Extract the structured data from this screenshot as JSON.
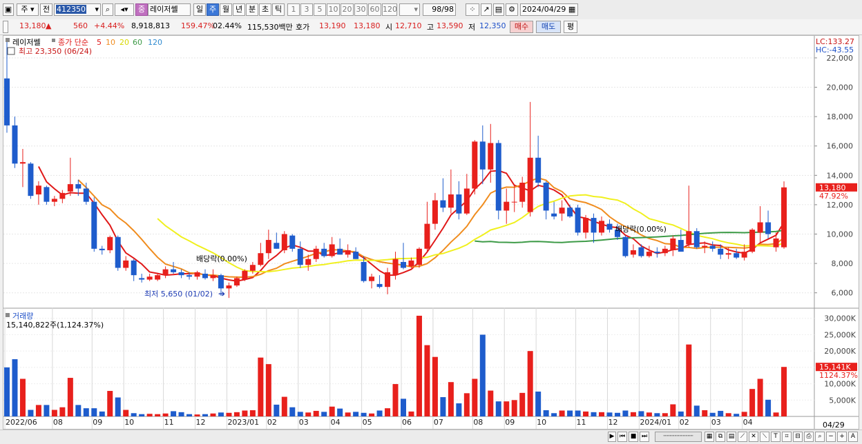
{
  "toolbar": {
    "market": "주",
    "scope": "전",
    "code": "412350",
    "name": "레이저쎌",
    "badge": "중",
    "periods": [
      "일",
      "주",
      "월",
      "년",
      "분",
      "초",
      "틱"
    ],
    "selected_period": "주",
    "minutes": [
      "1",
      "3",
      "5",
      "10",
      "20",
      "30",
      "60",
      "120"
    ],
    "count": "98/98",
    "date": "2024/04/29"
  },
  "quote": {
    "price": "13,180",
    "change": "560",
    "change_pct": "+4.44%",
    "volume": "8,918,813",
    "volume_ratio": "159.47%",
    "turnover": "02.44%",
    "amount": "115,530백만",
    "ask_label": "호가",
    "ask": "13,190",
    "bid": "13,180",
    "open_label": "시",
    "open": "12,710",
    "high_label": "고",
    "high": "13,590",
    "low_label": "저",
    "low": "12,350",
    "buy": "매수",
    "sell": "매도",
    "eval": "평"
  },
  "colors": {
    "up": "#e8201c",
    "down": "#1e5ccc",
    "ma5": "#e01818",
    "ma10": "#f08c1e",
    "ma20": "#f0f01e",
    "ma60": "#3c9a46",
    "ma120": "#2f8ad0"
  },
  "chart_data": {
    "type": "candlestick",
    "title": "레이저쎌",
    "legend": {
      "label": "종가 단순",
      "periods": [
        "5",
        "10",
        "20",
        "60",
        "120"
      ]
    },
    "lc_label": "LC:133.27",
    "hc_label": "HC:-43.55",
    "high_note": "최고 23,350 (06/24)",
    "low_note": "최저 5,650 (01/02)",
    "dividend_notes": [
      "배당락(0.00%)",
      "배당락(0.00%)"
    ],
    "price_axis": {
      "min": 5000,
      "max": 23500,
      "ticks": [
        6000,
        8000,
        10000,
        12000,
        14000,
        16000,
        18000,
        20000,
        22000
      ],
      "tick_labels": [
        "6,000",
        "8,000",
        "10,000",
        "12,000",
        "14,000",
        "16,000",
        "18,000",
        "20,000",
        "22,000"
      ]
    },
    "current_price_label": "13,180",
    "current_pct_label": "47.92%",
    "volume_title": "거래량",
    "volume_info": "15,140,822주(1,124.37%)",
    "volume_axis": {
      "max": 31000,
      "ticks": [
        5000,
        10000,
        15000,
        20000,
        25000,
        30000
      ],
      "tick_labels": [
        "5,000K",
        "10,000K",
        "15,000K",
        "20,000K",
        "25,000K",
        "30,000K"
      ]
    },
    "current_volume_label": "15,141K",
    "current_volume_pct": "1124.37%",
    "x_labels": [
      {
        "i": 0,
        "t": "2022/06"
      },
      {
        "i": 6,
        "t": "08"
      },
      {
        "i": 11,
        "t": "09"
      },
      {
        "i": 15,
        "t": "10"
      },
      {
        "i": 20,
        "t": "11"
      },
      {
        "i": 24,
        "t": "12"
      },
      {
        "i": 28,
        "t": "2023/01"
      },
      {
        "i": 33,
        "t": "02"
      },
      {
        "i": 37,
        "t": "03"
      },
      {
        "i": 41,
        "t": "04"
      },
      {
        "i": 45,
        "t": "05"
      },
      {
        "i": 50,
        "t": "06"
      },
      {
        "i": 54,
        "t": "07"
      },
      {
        "i": 59,
        "t": "08"
      },
      {
        "i": 63,
        "t": "09"
      },
      {
        "i": 67,
        "t": "10"
      },
      {
        "i": 72,
        "t": "11"
      },
      {
        "i": 76,
        "t": "12"
      },
      {
        "i": 80,
        "t": "2024/01"
      },
      {
        "i": 85,
        "t": "02"
      },
      {
        "i": 89,
        "t": "03"
      },
      {
        "i": 93,
        "t": "04"
      }
    ],
    "x_end_label": "04/29",
    "candles": [
      {
        "o": 20600,
        "h": 23350,
        "l": 16900,
        "c": 17400,
        "v": 15000
      },
      {
        "o": 17400,
        "h": 18000,
        "l": 14500,
        "c": 14800,
        "v": 17500
      },
      {
        "o": 14800,
        "h": 15800,
        "l": 13200,
        "c": 14900,
        "v": 11500
      },
      {
        "o": 14800,
        "h": 14900,
        "l": 12400,
        "c": 12600,
        "v": 2000
      },
      {
        "o": 12700,
        "h": 13600,
        "l": 12000,
        "c": 13300,
        "v": 3500
      },
      {
        "o": 13200,
        "h": 13300,
        "l": 12000,
        "c": 12200,
        "v": 3500
      },
      {
        "o": 12200,
        "h": 12600,
        "l": 11900,
        "c": 12400,
        "v": 2000
      },
      {
        "o": 12400,
        "h": 13000,
        "l": 12100,
        "c": 12800,
        "v": 2800
      },
      {
        "o": 12900,
        "h": 15200,
        "l": 12600,
        "c": 13400,
        "v": 11800
      },
      {
        "o": 13400,
        "h": 13700,
        "l": 12600,
        "c": 13100,
        "v": 3500
      },
      {
        "o": 13100,
        "h": 13500,
        "l": 12000,
        "c": 12200,
        "v": 2500
      },
      {
        "o": 12200,
        "h": 12500,
        "l": 8800,
        "c": 9000,
        "v": 2500
      },
      {
        "o": 9000,
        "h": 9200,
        "l": 8600,
        "c": 8900,
        "v": 1500
      },
      {
        "o": 8900,
        "h": 9900,
        "l": 8700,
        "c": 9800,
        "v": 7800
      },
      {
        "o": 9800,
        "h": 9900,
        "l": 7500,
        "c": 7700,
        "v": 5800
      },
      {
        "o": 7700,
        "h": 8500,
        "l": 7500,
        "c": 8200,
        "v": 2000
      },
      {
        "o": 8200,
        "h": 8300,
        "l": 6800,
        "c": 7200,
        "v": 1000
      },
      {
        "o": 7000,
        "h": 7300,
        "l": 6700,
        "c": 6900,
        "v": 700
      },
      {
        "o": 6900,
        "h": 7300,
        "l": 6800,
        "c": 7100,
        "v": 800
      },
      {
        "o": 6900,
        "h": 7300,
        "l": 6800,
        "c": 7200,
        "v": 700
      },
      {
        "o": 7200,
        "h": 7800,
        "l": 7000,
        "c": 7600,
        "v": 900
      },
      {
        "o": 7600,
        "h": 8100,
        "l": 7300,
        "c": 7400,
        "v": 1600
      },
      {
        "o": 7400,
        "h": 7600,
        "l": 7000,
        "c": 7200,
        "v": 1300
      },
      {
        "o": 7200,
        "h": 7400,
        "l": 6900,
        "c": 7100,
        "v": 700
      },
      {
        "o": 7100,
        "h": 7500,
        "l": 6900,
        "c": 7400,
        "v": 600
      },
      {
        "o": 7300,
        "h": 7600,
        "l": 6900,
        "c": 7000,
        "v": 700
      },
      {
        "o": 7000,
        "h": 7600,
        "l": 6800,
        "c": 7200,
        "v": 900
      },
      {
        "o": 7200,
        "h": 7300,
        "l": 5800,
        "c": 6300,
        "v": 1200
      },
      {
        "o": 6300,
        "h": 6700,
        "l": 5650,
        "c": 6500,
        "v": 1100
      },
      {
        "o": 6500,
        "h": 7100,
        "l": 6400,
        "c": 7000,
        "v": 1300
      },
      {
        "o": 6900,
        "h": 7600,
        "l": 6800,
        "c": 7500,
        "v": 1800
      },
      {
        "o": 7500,
        "h": 8100,
        "l": 7300,
        "c": 7900,
        "v": 1900
      },
      {
        "o": 7900,
        "h": 9400,
        "l": 7800,
        "c": 8700,
        "v": 18000
      },
      {
        "o": 8700,
        "h": 10300,
        "l": 8300,
        "c": 9600,
        "v": 16000
      },
      {
        "o": 9400,
        "h": 10100,
        "l": 9000,
        "c": 9000,
        "v": 3600
      },
      {
        "o": 8900,
        "h": 10200,
        "l": 8700,
        "c": 10000,
        "v": 6000
      },
      {
        "o": 9900,
        "h": 10000,
        "l": 8800,
        "c": 9000,
        "v": 2800
      },
      {
        "o": 9000,
        "h": 9500,
        "l": 7700,
        "c": 7900,
        "v": 1400
      },
      {
        "o": 7900,
        "h": 8600,
        "l": 7500,
        "c": 8300,
        "v": 1200
      },
      {
        "o": 8300,
        "h": 9200,
        "l": 8100,
        "c": 9000,
        "v": 1700
      },
      {
        "o": 9000,
        "h": 9400,
        "l": 8400,
        "c": 8500,
        "v": 1400
      },
      {
        "o": 8500,
        "h": 9800,
        "l": 8400,
        "c": 9300,
        "v": 3000
      },
      {
        "o": 9000,
        "h": 9700,
        "l": 8600,
        "c": 8600,
        "v": 2400
      },
      {
        "o": 8600,
        "h": 9300,
        "l": 8400,
        "c": 8900,
        "v": 1200
      },
      {
        "o": 8800,
        "h": 9100,
        "l": 8300,
        "c": 8300,
        "v": 1400
      },
      {
        "o": 8100,
        "h": 8500,
        "l": 6700,
        "c": 6800,
        "v": 1100
      },
      {
        "o": 6800,
        "h": 7300,
        "l": 6300,
        "c": 7100,
        "v": 900
      },
      {
        "o": 6600,
        "h": 7200,
        "l": 6300,
        "c": 6400,
        "v": 1800
      },
      {
        "o": 6400,
        "h": 7700,
        "l": 5900,
        "c": 7400,
        "v": 2500
      },
      {
        "o": 7200,
        "h": 8800,
        "l": 6900,
        "c": 8300,
        "v": 9900
      },
      {
        "o": 8100,
        "h": 9400,
        "l": 7600,
        "c": 7700,
        "v": 5400
      },
      {
        "o": 7800,
        "h": 8400,
        "l": 7700,
        "c": 8200,
        "v": 1500
      },
      {
        "o": 7900,
        "h": 9100,
        "l": 7700,
        "c": 9000,
        "v": 30800
      },
      {
        "o": 9000,
        "h": 12200,
        "l": 8800,
        "c": 10700,
        "v": 21800
      },
      {
        "o": 10700,
        "h": 12800,
        "l": 10300,
        "c": 12300,
        "v": 18200
      },
      {
        "o": 12300,
        "h": 13800,
        "l": 11500,
        "c": 11800,
        "v": 5900
      },
      {
        "o": 11800,
        "h": 14400,
        "l": 11400,
        "c": 12700,
        "v": 10500
      },
      {
        "o": 12700,
        "h": 13600,
        "l": 11000,
        "c": 11400,
        "v": 4000
      },
      {
        "o": 11400,
        "h": 14100,
        "l": 11300,
        "c": 13100,
        "v": 7100
      },
      {
        "o": 13100,
        "h": 16400,
        "l": 12700,
        "c": 16300,
        "v": 11500
      },
      {
        "o": 16300,
        "h": 17400,
        "l": 13400,
        "c": 14400,
        "v": 25000
      },
      {
        "o": 14400,
        "h": 17500,
        "l": 13500,
        "c": 16200,
        "v": 7900
      },
      {
        "o": 16200,
        "h": 16400,
        "l": 11000,
        "c": 11600,
        "v": 4600
      },
      {
        "o": 11600,
        "h": 13100,
        "l": 10700,
        "c": 12200,
        "v": 4600
      },
      {
        "o": 12200,
        "h": 13400,
        "l": 11500,
        "c": 12200,
        "v": 5000
      },
      {
        "o": 12200,
        "h": 13900,
        "l": 11800,
        "c": 13500,
        "v": 7200
      },
      {
        "o": 11500,
        "h": 19000,
        "l": 11200,
        "c": 15200,
        "v": 20000
      },
      {
        "o": 15200,
        "h": 16700,
        "l": 13200,
        "c": 13500,
        "v": 7600
      },
      {
        "o": 13500,
        "h": 13600,
        "l": 11000,
        "c": 11600,
        "v": 1900
      },
      {
        "o": 11400,
        "h": 12200,
        "l": 11000,
        "c": 11200,
        "v": 1000
      },
      {
        "o": 11400,
        "h": 12300,
        "l": 10900,
        "c": 11800,
        "v": 1800
      },
      {
        "o": 11800,
        "h": 12000,
        "l": 11100,
        "c": 11200,
        "v": 1800
      },
      {
        "o": 11800,
        "h": 12000,
        "l": 9900,
        "c": 10100,
        "v": 1800
      },
      {
        "o": 10100,
        "h": 11300,
        "l": 9700,
        "c": 11100,
        "v": 1500
      },
      {
        "o": 11100,
        "h": 11400,
        "l": 9400,
        "c": 10100,
        "v": 1300
      },
      {
        "o": 10100,
        "h": 11200,
        "l": 9900,
        "c": 10900,
        "v": 1300
      },
      {
        "o": 10700,
        "h": 11000,
        "l": 10100,
        "c": 10300,
        "v": 1200
      },
      {
        "o": 10300,
        "h": 10700,
        "l": 9600,
        "c": 9800,
        "v": 1100
      },
      {
        "o": 9800,
        "h": 9900,
        "l": 8400,
        "c": 8500,
        "v": 1800
      },
      {
        "o": 8600,
        "h": 9300,
        "l": 8400,
        "c": 8900,
        "v": 1300
      },
      {
        "o": 9100,
        "h": 9300,
        "l": 8400,
        "c": 8500,
        "v": 1600
      },
      {
        "o": 8500,
        "h": 9200,
        "l": 8400,
        "c": 8800,
        "v": 1200
      },
      {
        "o": 8800,
        "h": 9100,
        "l": 8400,
        "c": 8700,
        "v": 1000
      },
      {
        "o": 8700,
        "h": 9200,
        "l": 8500,
        "c": 9000,
        "v": 1000
      },
      {
        "o": 8900,
        "h": 9900,
        "l": 8500,
        "c": 9700,
        "v": 3700
      },
      {
        "o": 9600,
        "h": 10300,
        "l": 8800,
        "c": 8800,
        "v": 1500
      },
      {
        "o": 9300,
        "h": 13300,
        "l": 9100,
        "c": 10200,
        "v": 22000
      },
      {
        "o": 10200,
        "h": 10400,
        "l": 9000,
        "c": 9100,
        "v": 3300
      },
      {
        "o": 9100,
        "h": 9500,
        "l": 8700,
        "c": 9200,
        "v": 1900
      },
      {
        "o": 9200,
        "h": 9500,
        "l": 8800,
        "c": 9000,
        "v": 1100
      },
      {
        "o": 9000,
        "h": 9300,
        "l": 8300,
        "c": 8600,
        "v": 1700
      },
      {
        "o": 8600,
        "h": 9100,
        "l": 8300,
        "c": 8700,
        "v": 1000
      },
      {
        "o": 8700,
        "h": 9000,
        "l": 8300,
        "c": 8400,
        "v": 800
      },
      {
        "o": 8400,
        "h": 9300,
        "l": 8200,
        "c": 8800,
        "v": 1400
      },
      {
        "o": 8800,
        "h": 10400,
        "l": 8700,
        "c": 10300,
        "v": 8400
      },
      {
        "o": 10100,
        "h": 11900,
        "l": 9400,
        "c": 10800,
        "v": 11500
      },
      {
        "o": 10800,
        "h": 11600,
        "l": 9700,
        "c": 10000,
        "v": 5100
      },
      {
        "o": 9100,
        "h": 10100,
        "l": 8800,
        "c": 9700,
        "v": 1200
      },
      {
        "o": 9100,
        "h": 13590,
        "l": 9000,
        "c": 13180,
        "v": 15141
      }
    ]
  }
}
